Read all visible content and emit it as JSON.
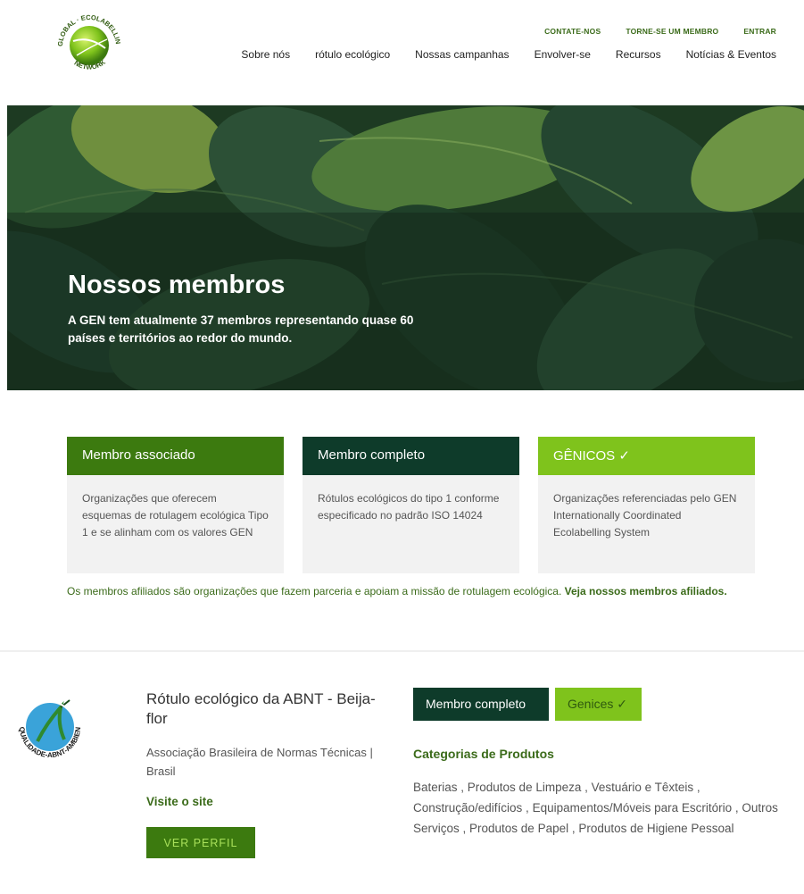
{
  "header": {
    "logo_text_top": "GLOBAL · ECOLABELLING",
    "logo_text_bottom": "NETWORK",
    "top_links": [
      "CONTATE-NOS",
      "TORNE-SE UM MEMBRO",
      "ENTRAR"
    ],
    "nav": [
      "Sobre nós",
      "rótulo ecológico",
      "Nossas campanhas",
      "Envolver-se",
      "Recursos",
      "Notícias & Eventos"
    ]
  },
  "hero": {
    "title": "Nossos membros",
    "subtitle": "A GEN tem atualmente 37 membros representando quase 60 países e territórios ao redor do mundo."
  },
  "cards": [
    {
      "title": "Membro associado",
      "body": "Organizações que oferecem esquemas de rotulagem ecológica Tipo 1 e se alinham com os valores GEN",
      "color": "#3c7a0f"
    },
    {
      "title": "Membro completo",
      "body": "Rótulos ecológicos do tipo 1 conforme especificado no padrão ISO 14024",
      "color": "#0e3b2a"
    },
    {
      "title": "GÊNICOS ✓",
      "body": "Organizações referenciadas pelo GEN Internationally Coordinated Ecolabelling System",
      "color": "#7fc31c"
    }
  ],
  "affiliates": {
    "text": "Os membros afiliados são organizações que fazem parceria e apoiam a missão de rotulagem ecológica. ",
    "link": "Veja nossos membros afiliados."
  },
  "member": {
    "logo_text": "QUALIDADE-ABNT-AMBIENTAL",
    "name": "Rótulo ecológico da ABNT - Beija-flor",
    "org": "Associação Brasileira de Normas Técnicas | Brasil",
    "visit": "Visite o site",
    "profile_button": "VER PERFIL",
    "badge_full": "Membro completo",
    "badge_genics": "Genices ✓",
    "categories_title": "Categorias de Produtos",
    "categories": "Baterias , Produtos de Limpeza , Vestuário e Têxteis , Construção/edifícios , Equipamentos/Móveis para Escritório , Outros Serviços , Produtos de Papel , Produtos de Higiene Pessoal"
  }
}
